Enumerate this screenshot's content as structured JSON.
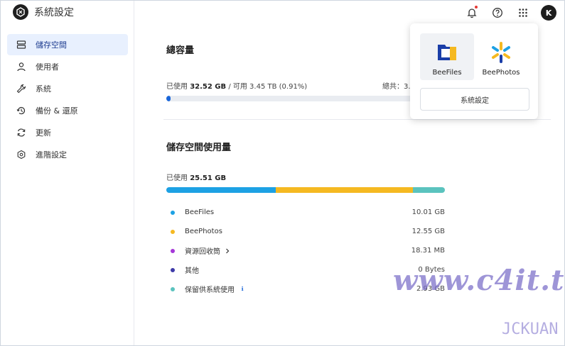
{
  "app": {
    "title": "系統設定"
  },
  "sidebar": {
    "items": [
      {
        "label": "儲存空間",
        "icon": "storage-icon",
        "active": true
      },
      {
        "label": "使用者",
        "icon": "user-icon",
        "active": false
      },
      {
        "label": "系統",
        "icon": "wrench-icon",
        "active": false
      },
      {
        "label": "備份 & 還原",
        "icon": "backup-restore-icon",
        "active": false
      },
      {
        "label": "更新",
        "icon": "refresh-icon",
        "active": false
      },
      {
        "label": "進階設定",
        "icon": "advanced-settings-icon",
        "active": false
      }
    ]
  },
  "topbar": {
    "avatar_initial": "K",
    "icons": [
      "bell-icon",
      "help-icon",
      "apps-grid-icon"
    ]
  },
  "capacity": {
    "title": "總容量",
    "used_prefix": "已使用",
    "used_value": "32.52 GB",
    "separator": " / 可用 ",
    "available_value": "3.45 TB (0.91%)",
    "total_label": "總共：3.",
    "used_fraction": 0.0091
  },
  "usage": {
    "title": "儲存空間使用量",
    "used_prefix": "已使用",
    "used_value": "25.51 GB",
    "items": [
      {
        "name": "BeeFiles",
        "value": "10.01 GB",
        "color": "#1da1e4",
        "bar_share": 0.392
      },
      {
        "name": "BeePhotos",
        "value": "12.55 GB",
        "color": "#f5b921",
        "bar_share": 0.492
      },
      {
        "name": "資源回收筒",
        "value": "18.31 MB",
        "color": "#a537d8",
        "has_chevron": true,
        "bar_share": 0
      },
      {
        "name": "其他",
        "value": "0 Bytes",
        "color": "#3e3aa8",
        "bar_share": 0
      },
      {
        "name": "保留供系統使用",
        "value": "2.93 GB",
        "color": "#5bc3be",
        "has_info": true,
        "bar_share": 0.116
      }
    ]
  },
  "popover": {
    "apps": [
      {
        "label": "BeeFiles",
        "icon": "beefiles-logo-icon"
      },
      {
        "label": "BeePhotos",
        "icon": "beephotos-logo-icon"
      }
    ],
    "settings_label": "系統設定"
  },
  "watermark": {
    "text": "www.c4it.tw",
    "sub": "JCKUAN"
  },
  "colors": {
    "accent": "#1a66d9",
    "active_bg": "#e8f0fe"
  }
}
